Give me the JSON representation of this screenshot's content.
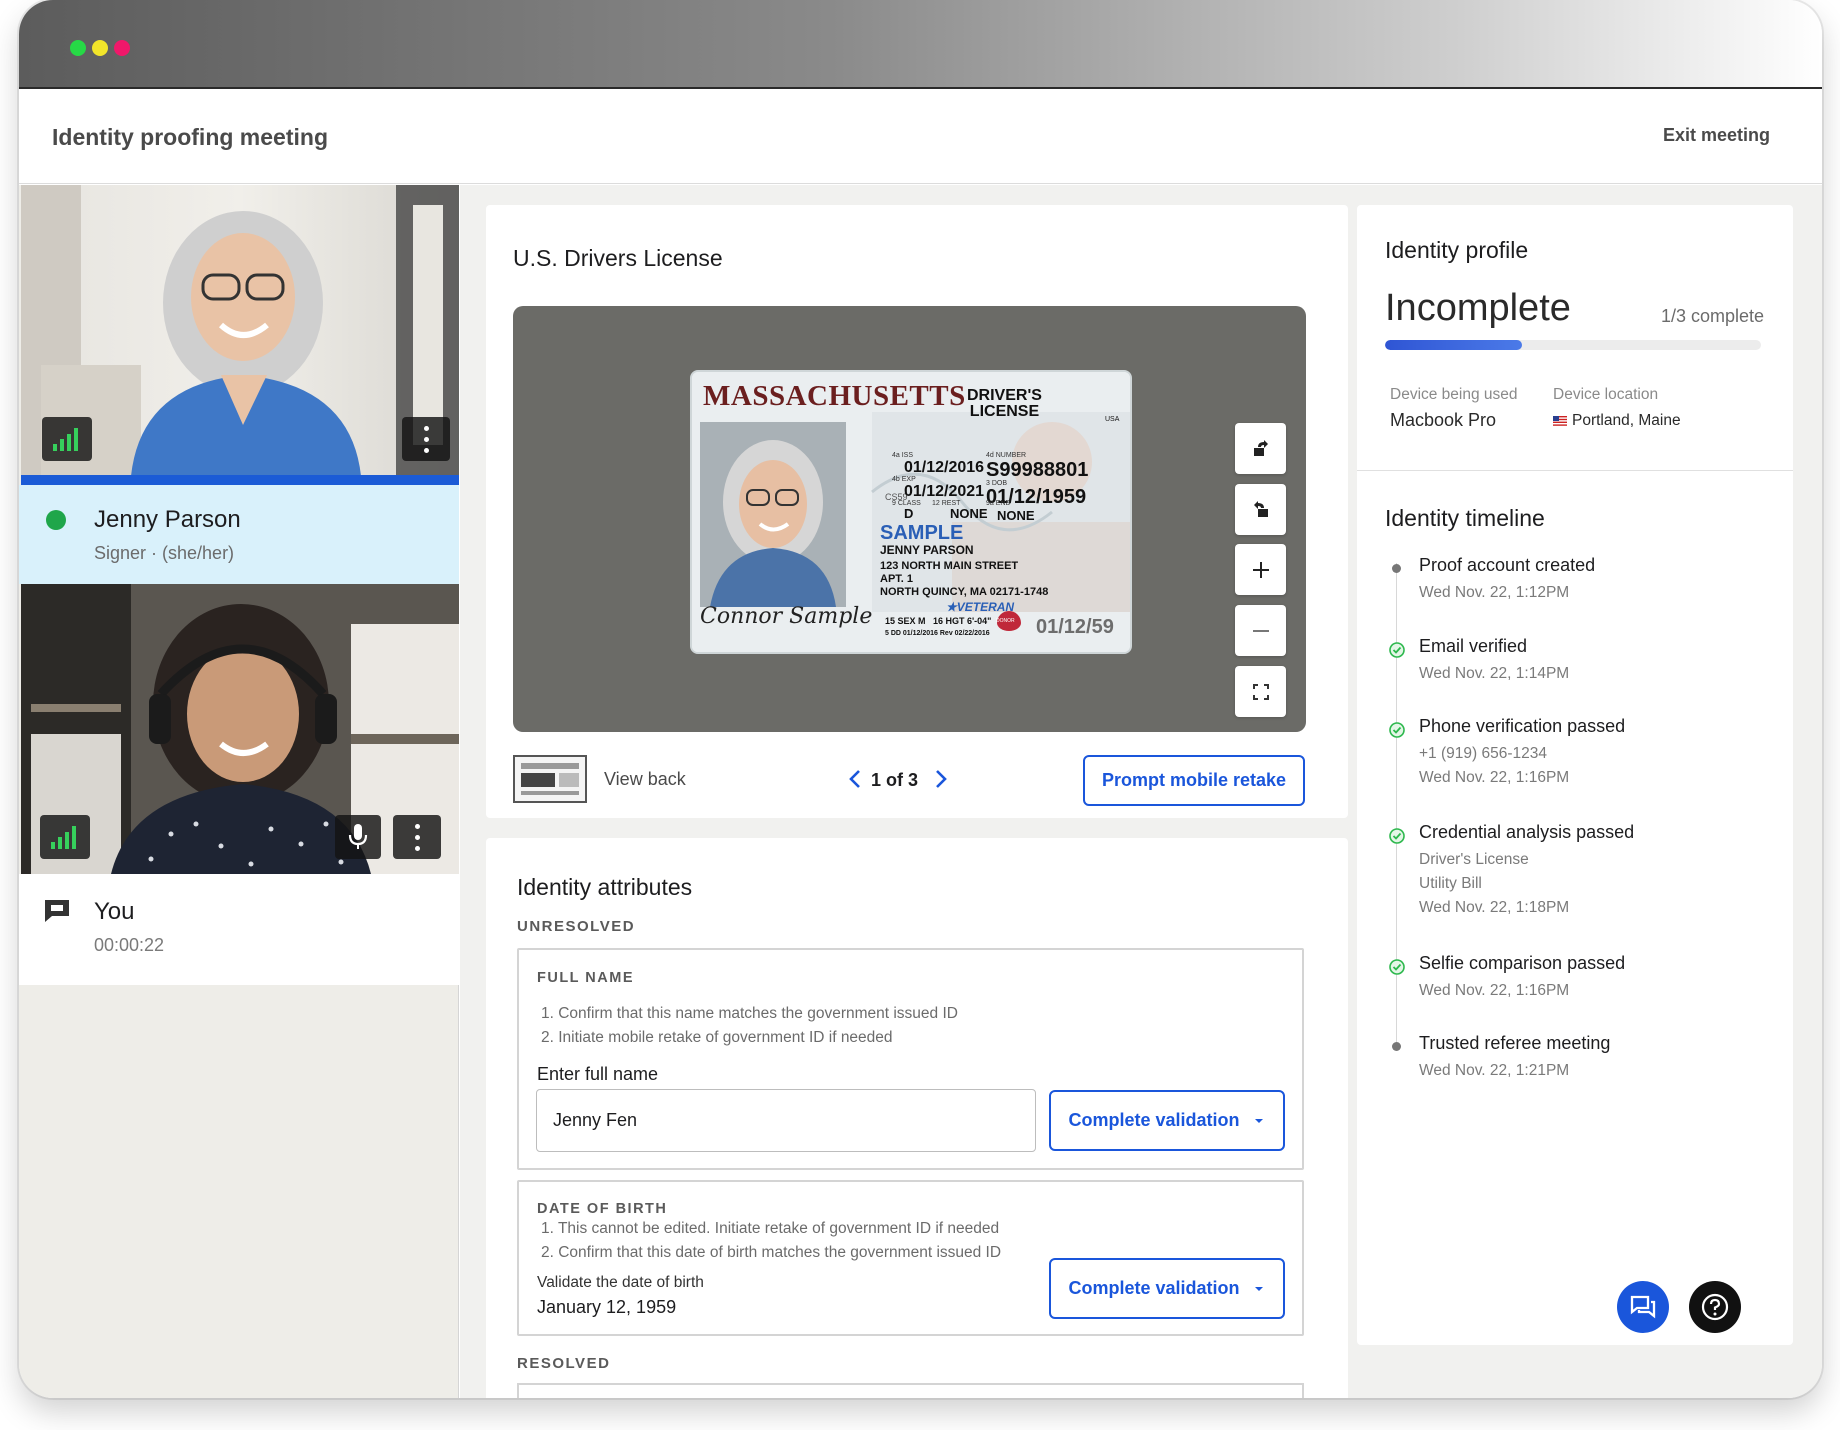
{
  "app": {
    "title": "Identity proofing meeting",
    "exit_label": "Exit meeting"
  },
  "window_dots": [
    "#26d946",
    "#f2e52a",
    "#f0186a"
  ],
  "participants": [
    {
      "name": "Jenny Parson",
      "role": "Signer · (she/her)",
      "status_color": "#1fa64a"
    },
    {
      "name": "You",
      "timer": "00:00:22"
    }
  ],
  "document": {
    "title": "U.S. Drivers License",
    "license": {
      "state": "MASSACHUSETTS",
      "type_line1": "DRIVER'S",
      "type_line2": "LICENSE",
      "usa": "USA",
      "iss_label": "4a ISS",
      "iss": "01/12/2016",
      "exp_label": "4b EXP",
      "exp": "01/12/2021",
      "number_label": "4d NUMBER",
      "number": "S99988801",
      "dob_label": "3 DOB",
      "dob": "01/12/1959",
      "class_label": "9 CLASS",
      "class": "D",
      "rest_label": "12 REST",
      "rest": "NONE",
      "end_label": "9a END",
      "end": "NONE",
      "sample": "SAMPLE",
      "name": "JENNY PARSON",
      "addr1": "123 NORTH MAIN STREET",
      "addr2": "APT. 1",
      "addr3": "NORTH QUINCY, MA 02171-1748",
      "veteran": "★VETERAN",
      "sex": "15 SEX M",
      "hgt": "16 HGT 6'-04\"",
      "dd": "5 DD 01/12/2016 Rev 02/22/2016",
      "dob_small": "01/12/59",
      "signature": "Connor Sample",
      "donor": "DONOR",
      "cs59": "CS59"
    },
    "view_back_label": "View back",
    "pager": "1 of 3",
    "retake_label": "Prompt mobile retake"
  },
  "attributes": {
    "title": "Identity attributes",
    "unresolved_label": "UNRESOLVED",
    "resolved_label": "RESOLVED",
    "full_name": {
      "label": "FULL NAME",
      "instructions": [
        "1. Confirm that this name matches the government issued ID",
        "2. Initiate mobile retake of government ID if needed"
      ],
      "field_label": "Enter full name",
      "value": "Jenny Fen",
      "button": "Complete validation"
    },
    "dob": {
      "label": "DATE OF BIRTH",
      "instructions": [
        "1. This cannot be edited. Initiate retake of government ID if needed",
        "2. Confirm that this date of birth matches the government issued ID"
      ],
      "field_label": "Validate the date of birth",
      "value": "January 12, 1959",
      "button": "Complete validation"
    }
  },
  "profile": {
    "title": "Identity profile",
    "status": "Incomplete",
    "progress_text": "1/3 complete",
    "progress_fraction": 0.365,
    "device_label": "Device being used",
    "device": "Macbook Pro",
    "location_label": "Device location",
    "location": "Portland, Maine"
  },
  "timeline": {
    "title": "Identity timeline",
    "items": [
      {
        "title": "Proof account created",
        "lines": [
          "Wed Nov. 22, 1:12PM"
        ],
        "state": "dot"
      },
      {
        "title": "Email verified",
        "lines": [
          "Wed Nov. 22, 1:14PM"
        ],
        "state": "check"
      },
      {
        "title": "Phone verification passed",
        "lines": [
          "+1 (919) 656-1234",
          "Wed Nov. 22, 1:16PM"
        ],
        "state": "check"
      },
      {
        "title": "Credential analysis passed",
        "lines": [
          "Driver's License",
          "Utility Bill",
          "Wed Nov. 22, 1:18PM"
        ],
        "state": "check"
      },
      {
        "title": "Selfie comparison passed",
        "lines": [
          "Wed Nov. 22, 1:16PM"
        ],
        "state": "check"
      },
      {
        "title": "Trusted referee meeting",
        "lines": [
          "Wed Nov. 22, 1:21PM"
        ],
        "state": "dot"
      }
    ]
  },
  "colors": {
    "accent": "#1a56db",
    "check": "#2db84d",
    "signer_highlight": "#d9f1fb"
  },
  "icons": [
    "signal-icon",
    "more-vertical-icon",
    "mic-icon",
    "chat-icon",
    "rotate-left-icon",
    "rotate-right-icon",
    "zoom-in-icon",
    "zoom-out-icon",
    "fullscreen-icon",
    "chevron-left-icon",
    "chevron-right-icon",
    "chevron-down-icon",
    "check-circle-icon",
    "help-icon",
    "us-flag-icon"
  ]
}
